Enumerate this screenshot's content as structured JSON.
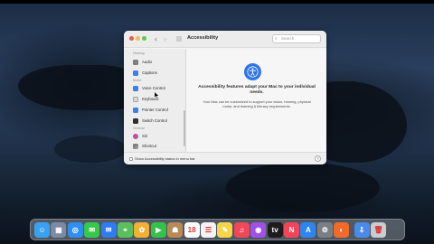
{
  "window": {
    "title": "Accessibility",
    "search_placeholder": "Search",
    "nav_back": "‹",
    "nav_forward": "›"
  },
  "sidebar": {
    "sections": [
      "Hearing",
      "Motor",
      "General"
    ],
    "items": [
      {
        "label": "Audio",
        "icon": "audio-icon"
      },
      {
        "label": "Captions",
        "icon": "captions-icon"
      },
      {
        "label": "Voice Control",
        "icon": "voice-control-icon"
      },
      {
        "label": "Keyboard",
        "icon": "keyboard-icon"
      },
      {
        "label": "Pointer Control",
        "icon": "pointer-control-icon"
      },
      {
        "label": "Switch Control",
        "icon": "switch-control-icon"
      },
      {
        "label": "Siri",
        "icon": "siri-icon"
      },
      {
        "label": "Shortcut",
        "icon": "shortcut-icon"
      }
    ]
  },
  "main": {
    "headline": "Accessibility features adapt your Mac to your individual needs.",
    "description": "Your Mac can be customized to support your vision, hearing, physical motor, and learning & literacy requirements."
  },
  "footer": {
    "checkbox_label": "Show Accessibility status in menu bar",
    "help": "?"
  },
  "dock": {
    "apps": [
      {
        "name": "Finder",
        "color": "#3aa0f2",
        "glyph": "☺"
      },
      {
        "name": "Launchpad",
        "color": "#7d8aa5",
        "glyph": "▦"
      },
      {
        "name": "Safari",
        "color": "#2e8ff0",
        "glyph": "◎"
      },
      {
        "name": "Messages",
        "color": "#37c94b",
        "glyph": "✉"
      },
      {
        "name": "Mail",
        "color": "#2f7bf0",
        "glyph": "✉"
      },
      {
        "name": "Maps",
        "color": "#5cbf5d",
        "glyph": "⌖"
      },
      {
        "name": "Photos",
        "color": "#f2b134",
        "glyph": "✿"
      },
      {
        "name": "FaceTime",
        "color": "#33c24a",
        "glyph": "▶"
      },
      {
        "name": "Contacts",
        "color": "#b88a56",
        "glyph": "☗"
      },
      {
        "name": "Calendar",
        "color": "#ffffff",
        "glyph": "18"
      },
      {
        "name": "Reminders",
        "color": "#f4f4f4",
        "glyph": "☰"
      },
      {
        "name": "Notes",
        "color": "#f6d54a",
        "glyph": "✎"
      },
      {
        "name": "Music",
        "color": "#f24759",
        "glyph": "♫"
      },
      {
        "name": "Podcasts",
        "color": "#a050e6",
        "glyph": "◉"
      },
      {
        "name": "Apple TV",
        "color": "#1c1c1c",
        "glyph": "tv"
      },
      {
        "name": "News",
        "color": "#f44458",
        "glyph": "N"
      },
      {
        "name": "App Store",
        "color": "#2e85f0",
        "glyph": "A"
      },
      {
        "name": "System Preferences",
        "color": "#7a7f86",
        "glyph": "⚙"
      },
      {
        "name": "Firefox",
        "color": "#f06a2a",
        "glyph": "◐"
      },
      {
        "name": "Downloads",
        "color": "#4a8ae8",
        "glyph": "⇩"
      },
      {
        "name": "Trash",
        "color": "#c9ccd1",
        "glyph": "🗑"
      }
    ]
  }
}
